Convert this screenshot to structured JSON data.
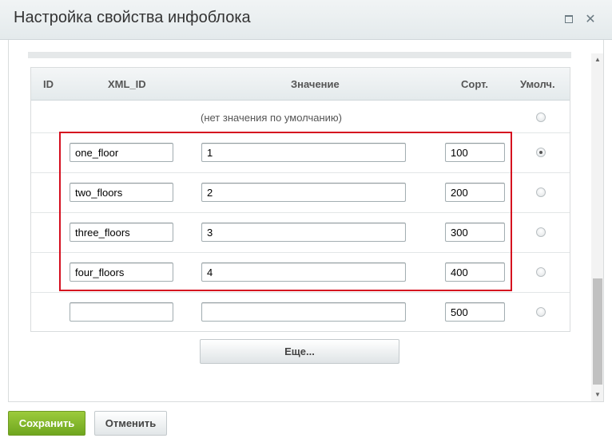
{
  "dialog": {
    "title": "Настройка свойства инфоблока",
    "maximize_icon": "maximize-icon",
    "close_icon": "close-icon"
  },
  "table": {
    "headers": {
      "id": "ID",
      "xml_id": "XML_ID",
      "value": "Значение",
      "sort": "Сорт.",
      "default": "Умолч."
    },
    "no_default_label": "(нет значения по умолчанию)",
    "rows": [
      {
        "xml_id": "one_floor",
        "value": "1",
        "sort": "100",
        "default_checked": true
      },
      {
        "xml_id": "two_floors",
        "value": "2",
        "sort": "200",
        "default_checked": false
      },
      {
        "xml_id": "three_floors",
        "value": "3",
        "sort": "300",
        "default_checked": false
      },
      {
        "xml_id": "four_floors",
        "value": "4",
        "sort": "400",
        "default_checked": false
      },
      {
        "xml_id": "",
        "value": "",
        "sort": "500",
        "default_checked": false
      }
    ],
    "highlight_color": "#d50f1f"
  },
  "buttons": {
    "more": "Еще...",
    "save": "Сохранить",
    "cancel": "Отменить"
  },
  "colors": {
    "save_green": "#7db52a"
  }
}
